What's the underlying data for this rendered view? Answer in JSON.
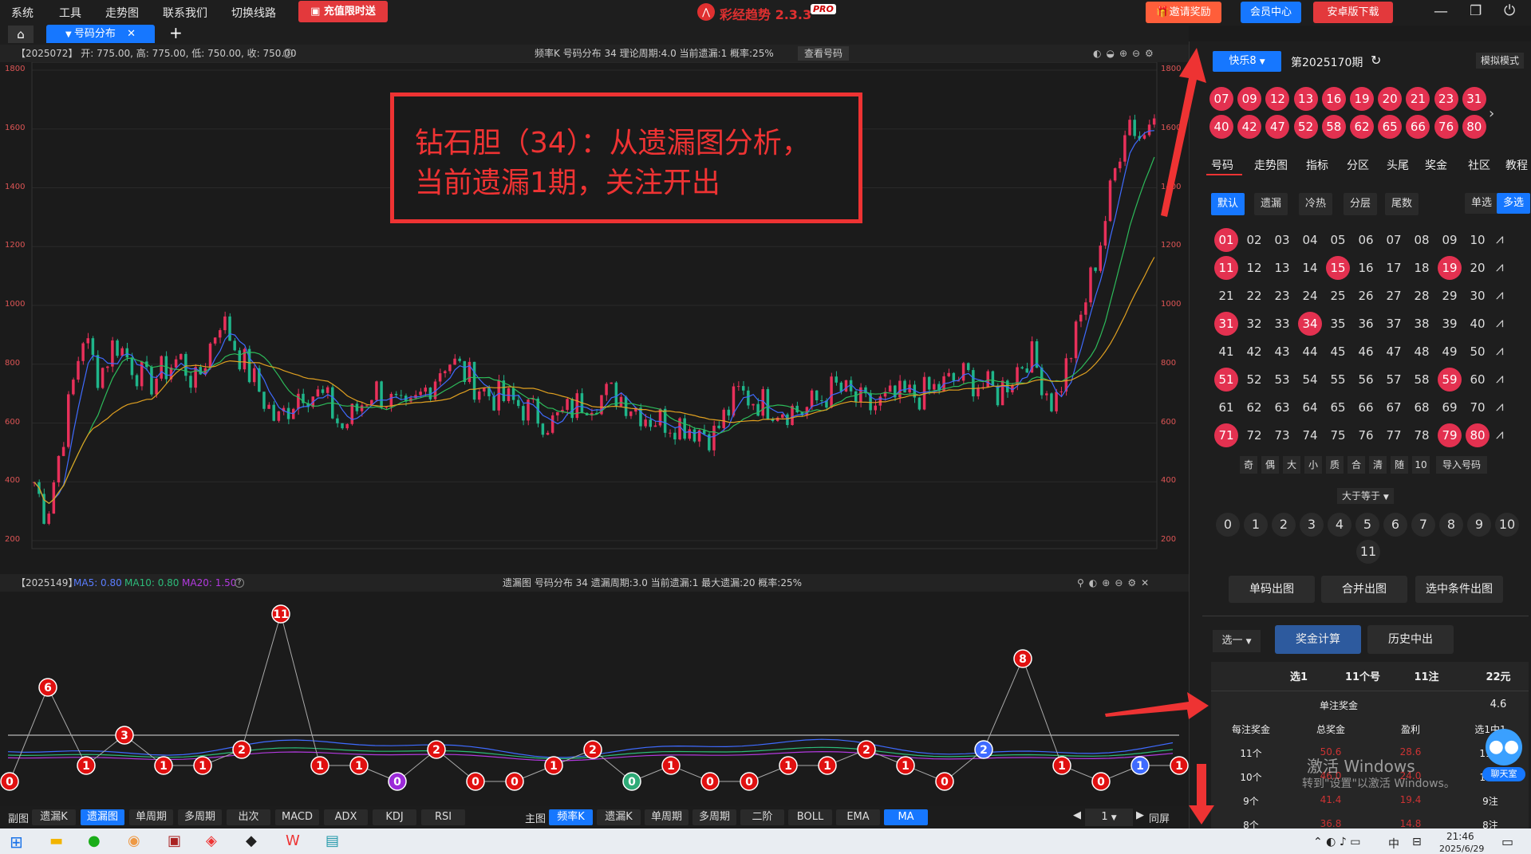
{
  "menu": {
    "items": [
      "系统",
      "工具",
      "走势图",
      "联系我们",
      "切换线路"
    ],
    "promo": "充值限时送",
    "app_title": "彩经趋势 2.3.3",
    "pro": "PRO",
    "invite": "邀请奖励",
    "member": "会员中心",
    "android": "安卓版下载"
  },
  "tabs": {
    "active": "号码分布",
    "add": "+"
  },
  "top_chart": {
    "info": "【2025072】 开: 775.00, 高: 775.00, 低: 750.00, 收: 750.00",
    "center": "频率K  号码分布  34   理论周期:4.0  当前遗漏:1  概率:25%",
    "lookup": "查看号码",
    "yticks": [
      "1800",
      "1600",
      "1400",
      "1200",
      "1000",
      "800",
      "600",
      "400",
      "200"
    ]
  },
  "annotation": {
    "line1": "钻石胆（34）：从遗漏图分析，",
    "line2": "当前遗漏1期，关注开出"
  },
  "bottom_chart": {
    "info": "【2025149】",
    "ma5": "MA5: 0.80",
    "ma10": "MA10: 0.80",
    "ma20": "MA20: 1.50",
    "center": "遗漏图  号码分布  34   遗漏周期:3.0  当前遗漏:1  最大遗漏:20  概率:25%",
    "labels": [
      "0",
      "6",
      "1",
      "3",
      "1",
      "1",
      "2",
      "11",
      "1",
      "1",
      "0",
      "2",
      "0",
      "0",
      "1",
      "2",
      "0",
      "1",
      "0",
      "0",
      "1",
      "1",
      "2",
      "1",
      "0",
      "2",
      "8",
      "1",
      "0",
      "1",
      "1"
    ]
  },
  "bottom_bar": {
    "sub": "副图",
    "sub_btns": [
      "遗漏K",
      "遗漏图",
      "单周期",
      "多周期",
      "出次",
      "MACD",
      "ADX",
      "KDJ",
      "RSI"
    ],
    "main": "主图",
    "main_btns": [
      "频率K",
      "遗漏K",
      "单周期",
      "多周期",
      "二阶",
      "BOLL",
      "EMA",
      "MA"
    ],
    "page": "1",
    "fullscreen": "同屏"
  },
  "right": {
    "game": "快乐8",
    "period": "第2025170期",
    "mock": "模拟模式",
    "draw_row1": [
      "07",
      "09",
      "12",
      "13",
      "16",
      "19",
      "20",
      "21",
      "23",
      "31"
    ],
    "draw_row2": [
      "40",
      "42",
      "47",
      "52",
      "58",
      "62",
      "65",
      "66",
      "76",
      "80"
    ],
    "nav": [
      "号码",
      "走势图",
      "指标",
      "分区",
      "头尾",
      "奖金",
      "社区",
      "教程"
    ],
    "filters": [
      "默认",
      "遗漏",
      "冷热",
      "分层",
      "尾数"
    ],
    "single": "单选",
    "multi": "多选",
    "grid": [
      [
        "01",
        "02",
        "03",
        "04",
        "05",
        "06",
        "07",
        "08",
        "09",
        "10"
      ],
      [
        "11",
        "12",
        "13",
        "14",
        "15",
        "16",
        "17",
        "18",
        "19",
        "20"
      ],
      [
        "21",
        "22",
        "23",
        "24",
        "25",
        "26",
        "27",
        "28",
        "29",
        "30"
      ],
      [
        "31",
        "32",
        "33",
        "34",
        "35",
        "36",
        "37",
        "38",
        "39",
        "40"
      ],
      [
        "41",
        "42",
        "43",
        "44",
        "45",
        "46",
        "47",
        "48",
        "49",
        "50"
      ],
      [
        "51",
        "52",
        "53",
        "54",
        "55",
        "56",
        "57",
        "58",
        "59",
        "60"
      ],
      [
        "61",
        "62",
        "63",
        "64",
        "65",
        "66",
        "67",
        "68",
        "69",
        "70"
      ],
      [
        "71",
        "72",
        "73",
        "74",
        "75",
        "76",
        "77",
        "78",
        "79",
        "80"
      ]
    ],
    "quick": [
      "奇",
      "偶",
      "大",
      "小",
      "质",
      "合",
      "清",
      "随",
      "10"
    ],
    "import": "导入号码",
    "cmp": "大于等于",
    "counts": [
      "0",
      "1",
      "2",
      "3",
      "4",
      "5",
      "6",
      "7",
      "8",
      "9",
      "10",
      "11"
    ],
    "actions": [
      "单码出图",
      "合并出图",
      "选中条件出图"
    ],
    "select": "选一",
    "calc": "奖金计算",
    "history": "历史中出",
    "prize": {
      "head": [
        "选1",
        "11个号",
        "11注",
        "22元"
      ],
      "single": "单注奖金",
      "single_val": "4.6",
      "cols": [
        "每注奖金",
        "总奖金",
        "盈利",
        "选1中1"
      ],
      "rows": [
        [
          "11个",
          "50.6",
          "28.6",
          "11注"
        ],
        [
          "10个",
          "46.0",
          "24.0",
          "10注"
        ],
        [
          "9个",
          "41.4",
          "19.4",
          "9注"
        ],
        [
          "8个",
          "36.8",
          "14.8",
          "8注"
        ]
      ]
    },
    "chat": "聊天室",
    "watermark1": "激活 Windows",
    "watermark2": "转到\"设置\"以激活 Windows。"
  },
  "taskbar": {
    "time": "21:46",
    "date": "2025/6/29",
    "lang": "中"
  }
}
